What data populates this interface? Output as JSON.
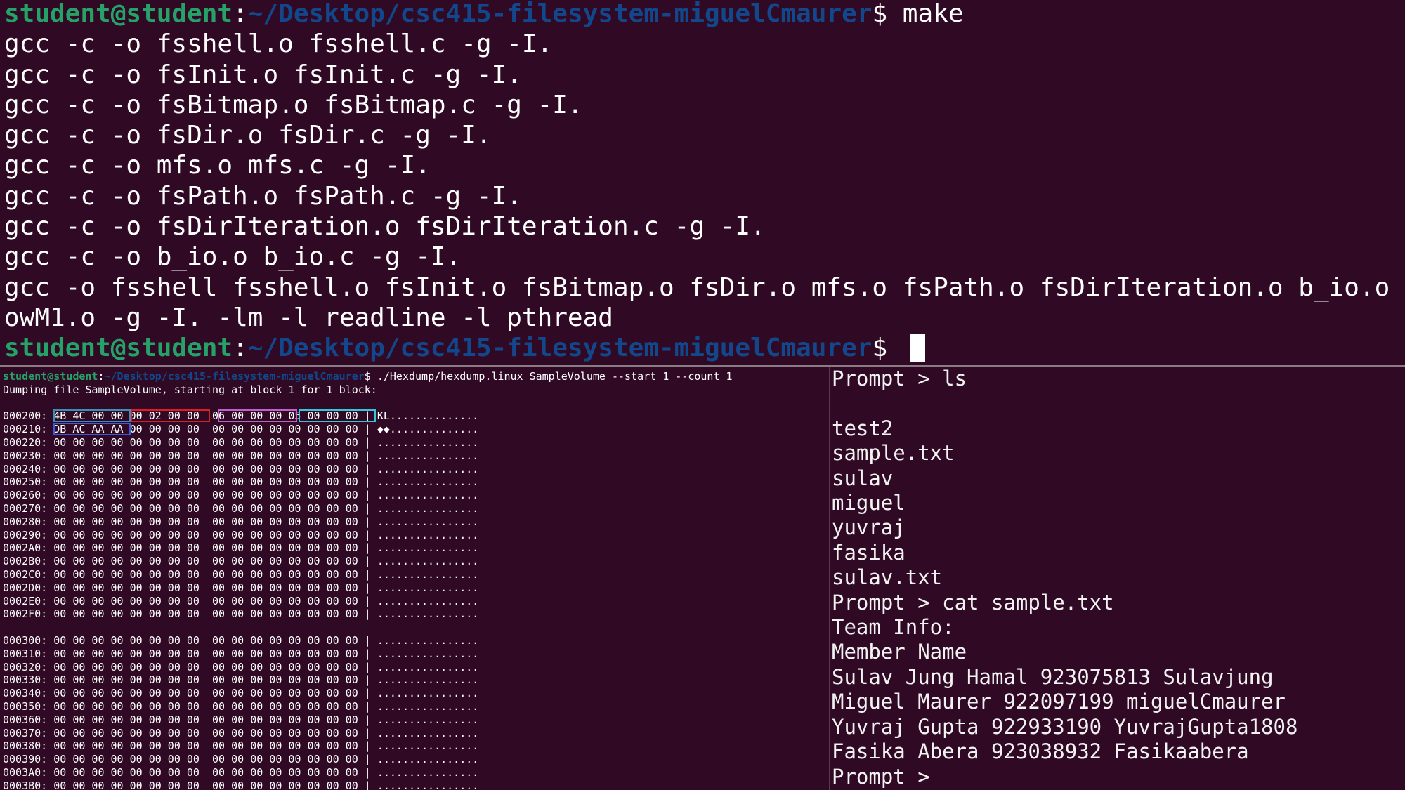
{
  "top_terminal": {
    "prompt_user": "student@student",
    "prompt_sep": ":",
    "prompt_path": "~/Desktop/csc415-filesystem-miguelCmaurer",
    "prompt_dollar": "$ ",
    "command": "make",
    "output_lines": [
      "gcc -c -o fsshell.o fsshell.c -g -I.",
      "gcc -c -o fsInit.o fsInit.c -g -I.",
      "gcc -c -o fsBitmap.o fsBitmap.c -g -I.",
      "gcc -c -o fsDir.o fsDir.c -g -I.",
      "gcc -c -o mfs.o mfs.c -g -I.",
      "gcc -c -o fsPath.o fsPath.c -g -I.",
      "gcc -c -o fsDirIteration.o fsDirIteration.c -g -I.",
      "gcc -c -o b_io.o b_io.c -g -I.",
      "gcc -o fsshell fsshell.o fsInit.o fsBitmap.o fsDir.o mfs.o fsPath.o fsDirIteration.o b_io.o fsL",
      "owM1.o -g -I. -lm -l readline -l pthread"
    ],
    "final_prompt_dollar": "$ "
  },
  "hex_terminal": {
    "prompt_user": "student@student",
    "prompt_sep": ":",
    "prompt_path": "~/Desktop/csc415-filesystem-miguelCmaurer",
    "prompt_dollar": "$ ",
    "command": "./Hexdump/hexdump.linux SampleVolume --start 1 --count 1",
    "info": "Dumping file SampleVolume, starting at block 1 for 1 block:",
    "rows_block1": [
      "000200: 4B 4C 00 00 00 02 00 00  06 00 00 00 05 00 00 00 | KL..............",
      "000210: DB AC AA AA 00 00 00 00  00 00 00 00 00 00 00 00 | ◆◆..............",
      "000220: 00 00 00 00 00 00 00 00  00 00 00 00 00 00 00 00 | ................",
      "000230: 00 00 00 00 00 00 00 00  00 00 00 00 00 00 00 00 | ................",
      "000240: 00 00 00 00 00 00 00 00  00 00 00 00 00 00 00 00 | ................",
      "000250: 00 00 00 00 00 00 00 00  00 00 00 00 00 00 00 00 | ................",
      "000260: 00 00 00 00 00 00 00 00  00 00 00 00 00 00 00 00 | ................",
      "000270: 00 00 00 00 00 00 00 00  00 00 00 00 00 00 00 00 | ................",
      "000280: 00 00 00 00 00 00 00 00  00 00 00 00 00 00 00 00 | ................",
      "000290: 00 00 00 00 00 00 00 00  00 00 00 00 00 00 00 00 | ................",
      "0002A0: 00 00 00 00 00 00 00 00  00 00 00 00 00 00 00 00 | ................",
      "0002B0: 00 00 00 00 00 00 00 00  00 00 00 00 00 00 00 00 | ................",
      "0002C0: 00 00 00 00 00 00 00 00  00 00 00 00 00 00 00 00 | ................",
      "0002D0: 00 00 00 00 00 00 00 00  00 00 00 00 00 00 00 00 | ................",
      "0002E0: 00 00 00 00 00 00 00 00  00 00 00 00 00 00 00 00 | ................",
      "0002F0: 00 00 00 00 00 00 00 00  00 00 00 00 00 00 00 00 | ................"
    ],
    "rows_block2": [
      "000300: 00 00 00 00 00 00 00 00  00 00 00 00 00 00 00 00 | ................",
      "000310: 00 00 00 00 00 00 00 00  00 00 00 00 00 00 00 00 | ................",
      "000320: 00 00 00 00 00 00 00 00  00 00 00 00 00 00 00 00 | ................",
      "000330: 00 00 00 00 00 00 00 00  00 00 00 00 00 00 00 00 | ................",
      "000340: 00 00 00 00 00 00 00 00  00 00 00 00 00 00 00 00 | ................",
      "000350: 00 00 00 00 00 00 00 00  00 00 00 00 00 00 00 00 | ................",
      "000360: 00 00 00 00 00 00 00 00  00 00 00 00 00 00 00 00 | ................",
      "000370: 00 00 00 00 00 00 00 00  00 00 00 00 00 00 00 00 | ................",
      "000380: 00 00 00 00 00 00 00 00  00 00 00 00 00 00 00 00 | ................",
      "000390: 00 00 00 00 00 00 00 00  00 00 00 00 00 00 00 00 | ................",
      "0003A0: 00 00 00 00 00 00 00 00  00 00 00 00 00 00 00 00 | ................",
      "0003B0: 00 00 00 00 00 00 00 00  00 00 00 00 00 00 00 00 | ................"
    ],
    "highlight_colors": [
      "#3a8fb7",
      "#e01b24",
      "#c061cb",
      "#33c7de",
      "#3b5bdb"
    ]
  },
  "shell_terminal": {
    "lines": [
      "Prompt > ls",
      "",
      "test2",
      "sample.txt",
      "sulav",
      "miguel",
      "yuvraj",
      "fasika",
      "sulav.txt",
      "Prompt > cat sample.txt",
      "Team Info:",
      "Member Name",
      "Sulav Jung Hamal 923075813 Sulavjung",
      "Miguel Maurer 922097199 miguelCmaurer",
      "Yuvraj Gupta 922933190 YuvrajGupta1808",
      "Fasika Abera 923038932 Fasikaabera",
      "Prompt > "
    ]
  },
  "colors": {
    "background": "#300a24",
    "prompt_user": "#26a269",
    "prompt_path": "#12488b",
    "text": "#ffffff"
  }
}
